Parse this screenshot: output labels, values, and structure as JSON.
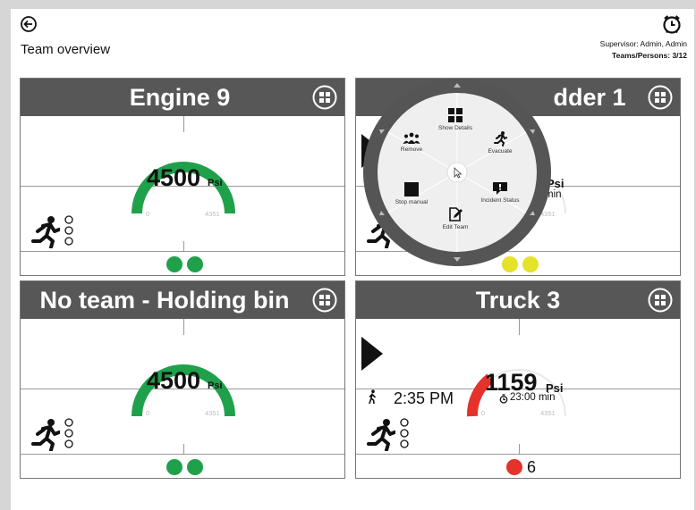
{
  "header": {
    "title": "Team overview",
    "supervisor": "Supervisor: Admin, Admin",
    "teams_persons": "Teams/Persons: 3/12"
  },
  "cards": [
    {
      "title": "Engine 9",
      "pressure": "4500",
      "unit": "Psi",
      "min": "0",
      "max": "4351",
      "gauge_color": "#1fa14b",
      "dot_color": "#1fa14b"
    },
    {
      "title": "Ladder 1",
      "visible_title": "dder 1",
      "pressure": "",
      "unit": "Psi",
      "time_left": "min",
      "max": "4351",
      "dot_color": "#e6e22a"
    },
    {
      "title": "No team - Holding bin",
      "pressure": "4500",
      "unit": "Psi",
      "min": "0",
      "max": "4351",
      "gauge_color": "#1fa14b",
      "dot_color": "#1fa14b"
    },
    {
      "title": "Truck 3",
      "pressure": "1159",
      "unit": "Psi",
      "time_left": "23:00 min",
      "walk_time": "2:35 PM",
      "min": "0",
      "max": "4351",
      "gauge_color": "#e5322b",
      "alarm_count": "6",
      "dot_color": "#e5322b"
    }
  ],
  "radial_menu": {
    "show_details": "Show Details",
    "evacuate": "Evacuate",
    "incident_status": "Incident Status",
    "edit_team": "Edit Team",
    "stop_manual": "Stop manual",
    "remove": "Remove"
  },
  "icons": {
    "back": "back-arrow-icon",
    "alarm": "alarm-clock-icon",
    "grid": "grid-icon",
    "runner": "running-person-icon",
    "walker": "walking-person-icon",
    "stopwatch": "stopwatch-icon"
  }
}
